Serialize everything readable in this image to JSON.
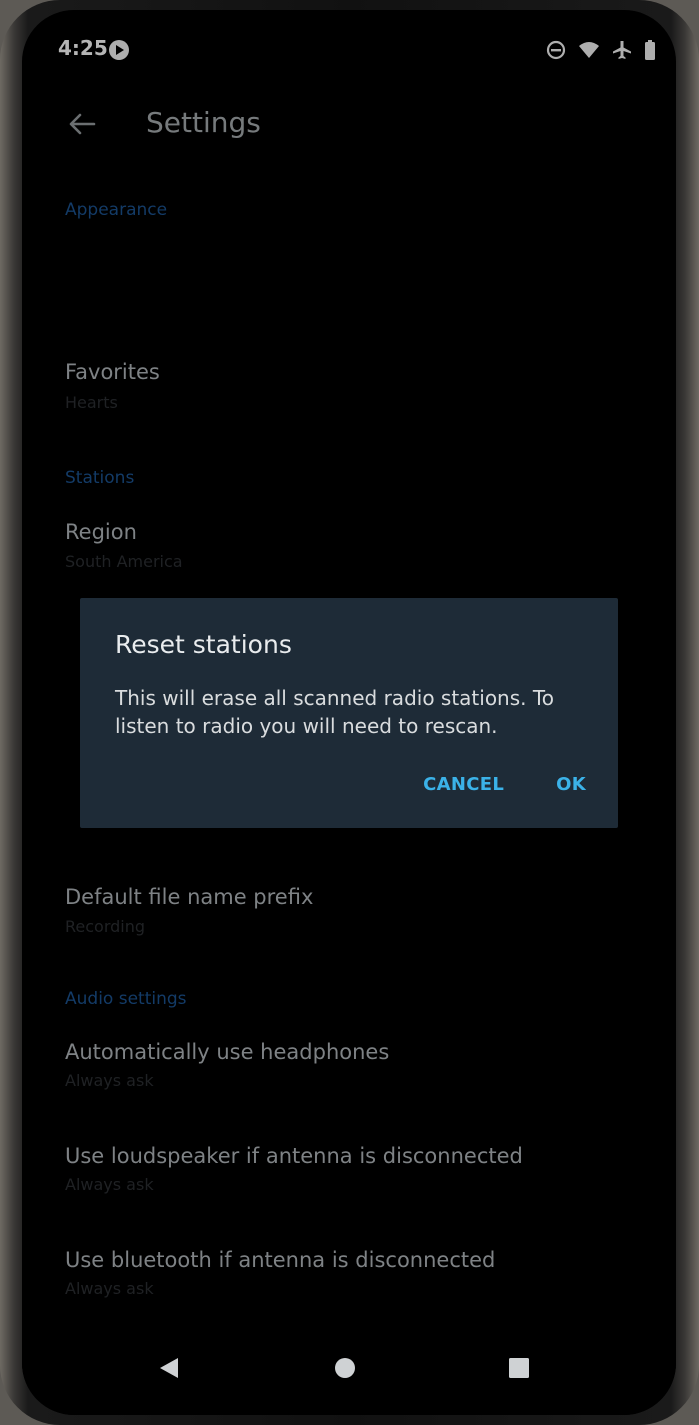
{
  "status_bar": {
    "time": "4:25",
    "icons": [
      "app-notification-icon",
      "do-not-disturb-icon",
      "wifi-icon",
      "airplane-mode-icon",
      "battery-icon"
    ]
  },
  "app_bar": {
    "title": "Settings",
    "back_icon": "arrow-back-icon"
  },
  "settings": {
    "appearance_header": "Appearance",
    "favorites": {
      "title": "Favorites",
      "summary": "Hearts"
    },
    "stations_header": "Stations",
    "region": {
      "title": "Region",
      "summary": "South America"
    },
    "default_file_name_prefix": {
      "title": "Default file name prefix",
      "summary": "Recording"
    },
    "audio_settings_header": "Audio settings",
    "auto_headphones": {
      "title": "Automatically use headphones",
      "summary": "Always ask"
    },
    "loudspeaker": {
      "title": "Use loudspeaker if antenna is disconnected",
      "summary": "Always ask"
    },
    "bluetooth": {
      "title": "Use bluetooth if antenna is disconnected",
      "summary": "Always ask"
    }
  },
  "dialog": {
    "title": "Reset stations",
    "message": "This will erase all scanned radio stations. To listen to radio you will need to rescan.",
    "cancel_label": "CANCEL",
    "ok_label": "OK"
  },
  "nav_bar": {
    "icons": [
      "nav-back-icon",
      "nav-home-icon",
      "nav-recents-icon"
    ]
  },
  "colors": {
    "accent": "#3bb2e8",
    "dialog_background": "#1e2b37",
    "section_header": "#1a4f8a"
  }
}
